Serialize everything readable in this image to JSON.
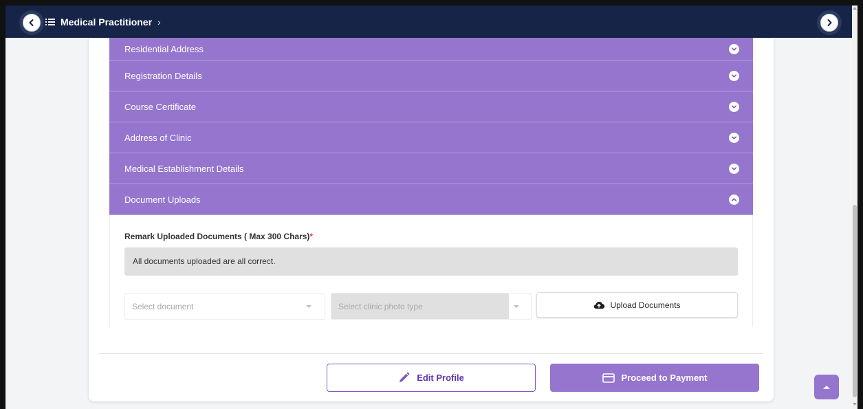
{
  "header": {
    "breadcrumb_title": "Medical Practitioner",
    "back_icon": "chevron-left-icon",
    "forward_icon": "chevron-right-icon",
    "menu_icon": "list-icon"
  },
  "accordion": {
    "sections": [
      {
        "label": "Residential Address",
        "state": "collapsed"
      },
      {
        "label": "Registration Details",
        "state": "collapsed"
      },
      {
        "label": "Course Certificate",
        "state": "collapsed"
      },
      {
        "label": "Address of Clinic",
        "state": "collapsed"
      },
      {
        "label": "Medical Establishment Details",
        "state": "collapsed"
      },
      {
        "label": "Document Uploads",
        "state": "expanded"
      }
    ]
  },
  "uploads": {
    "remark_label": "Remark Uploaded Documents ( Max 300 Chars)",
    "required_mark": "*",
    "remark_value": "All documents uploaded are all correct.",
    "select_document_placeholder": "Select document",
    "select_photo_placeholder": "Select clinic photo type",
    "upload_button_label": "Upload Documents"
  },
  "actions": {
    "edit_profile_label": "Edit Profile",
    "proceed_payment_label": "Proceed to Payment"
  },
  "colors": {
    "header_bg": "#152447",
    "accordion_bg": "#9575cd",
    "accent_purple": "#7e57c2",
    "page_bg": "#f3f4f6"
  }
}
